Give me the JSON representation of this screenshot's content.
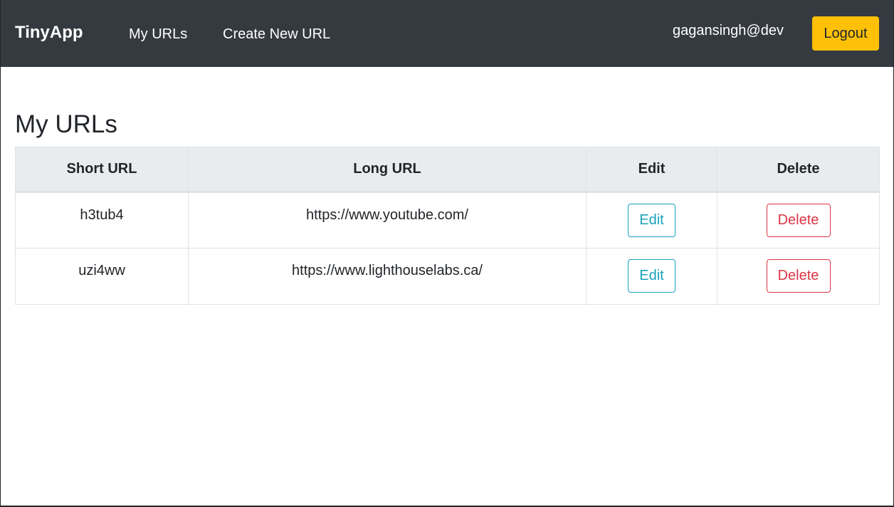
{
  "navbar": {
    "brand": "TinyApp",
    "links": [
      {
        "label": "My URLs"
      },
      {
        "label": "Create New URL"
      }
    ],
    "user": "gagansingh@dev",
    "logout_label": "Logout",
    "colors": {
      "background": "#343a40",
      "logout": "#ffc107"
    }
  },
  "main": {
    "title": "My URLs",
    "table": {
      "headers": [
        "Short URL",
        "Long URL",
        "Edit",
        "Delete"
      ],
      "rows": [
        {
          "short": "h3tub4",
          "long": "https://www.youtube.com/",
          "edit_label": "Edit",
          "delete_label": "Delete"
        },
        {
          "short": "uzi4ww",
          "long": "https://www.lighthouselabs.ca/",
          "edit_label": "Edit",
          "delete_label": "Delete"
        }
      ]
    },
    "colors": {
      "edit": "#17a2b8",
      "delete": "#dc3545",
      "header_bg": "#e9ecef"
    }
  }
}
